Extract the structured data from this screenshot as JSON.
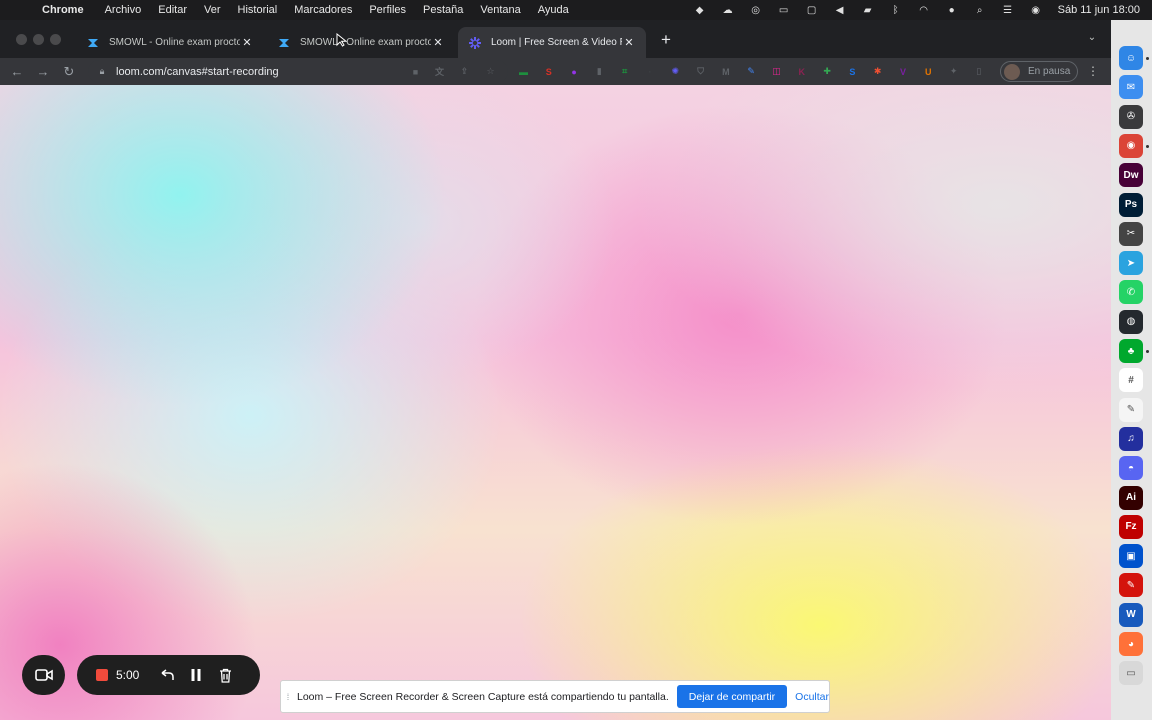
{
  "menubar": {
    "app": "Chrome",
    "items": [
      "Archivo",
      "Editar",
      "Ver",
      "Historial",
      "Marcadores",
      "Perfiles",
      "Pestaña",
      "Ventana",
      "Ayuda"
    ],
    "status_icons": [
      "dropbox-icon",
      "cloud-icon",
      "creative-cloud-icon",
      "screen-icon",
      "display-icon",
      "volume-icon",
      "battery-icon",
      "bluetooth-icon",
      "wifi-icon",
      "user-icon",
      "search-icon",
      "control-center-icon",
      "siri-icon"
    ],
    "clock": "Sáb 11 jun  18:00"
  },
  "tabs": [
    {
      "title": "SMOWL - Online exam proctor",
      "favicon": "smowl-icon",
      "active": false
    },
    {
      "title": "SMOWL - Online exam proctor",
      "favicon": "smowl-icon",
      "active": false
    },
    {
      "title": "Loom | Free Screen & Video Re",
      "favicon": "loom-icon",
      "active": true
    }
  ],
  "toolbar": {
    "url": "loom.com/canvas#start-recording",
    "profile_label": "En pausa"
  },
  "extensions": [
    {
      "name": "camera-icon",
      "color": "#5f6368",
      "glyph": "■"
    },
    {
      "name": "translate-icon",
      "color": "#5f6368",
      "glyph": "文"
    },
    {
      "name": "share-icon",
      "color": "#5f6368",
      "glyph": "⇪"
    },
    {
      "name": "star-icon",
      "color": "#5f6368",
      "glyph": "☆"
    },
    {
      "name": "ext-green-icon",
      "color": "#1e8e3e",
      "glyph": "▬"
    },
    {
      "name": "ext-red-icon",
      "color": "#d93025",
      "glyph": "S"
    },
    {
      "name": "ext-purple-icon",
      "color": "#9334e6",
      "glyph": "●"
    },
    {
      "name": "ext-gray-icon",
      "color": "#5f6368",
      "glyph": "▮"
    },
    {
      "name": "ext-frame-icon",
      "color": "#1e8e3e",
      "glyph": "⌗"
    },
    {
      "name": "ext-dark-icon",
      "color": "#3c4043",
      "glyph": "·"
    },
    {
      "name": "loom-ext-icon",
      "color": "#625df5",
      "glyph": "✺"
    },
    {
      "name": "shield-icon",
      "color": "#5f6368",
      "glyph": "⛉"
    },
    {
      "name": "gmail-icon",
      "color": "#5f6368",
      "glyph": "M"
    },
    {
      "name": "pen-icon",
      "color": "#4285f4",
      "glyph": "✎"
    },
    {
      "name": "ext-pink-icon",
      "color": "#e52592",
      "glyph": "◫"
    },
    {
      "name": "ext-k-icon",
      "color": "#8b2252",
      "glyph": "K"
    },
    {
      "name": "ext-green2-icon",
      "color": "#34a853",
      "glyph": "✚"
    },
    {
      "name": "ext-s-icon",
      "color": "#1a73e8",
      "glyph": "S"
    },
    {
      "name": "ext-orange-icon",
      "color": "#f05032",
      "glyph": "✱"
    },
    {
      "name": "ext-v-icon",
      "color": "#7b1fa2",
      "glyph": "V"
    },
    {
      "name": "ext-u-icon",
      "color": "#e37400",
      "glyph": "U"
    },
    {
      "name": "puzzle-icon",
      "color": "#5f6368",
      "glyph": "✦"
    },
    {
      "name": "sidepanel-icon",
      "color": "#5f6368",
      "glyph": "▯"
    }
  ],
  "dock": [
    {
      "name": "finder-icon",
      "color": "#2f86e6",
      "glyph": "☺"
    },
    {
      "name": "mail-icon",
      "color": "#3d8ef0",
      "glyph": "✉"
    },
    {
      "name": "safari-icon",
      "color": "#3a3a3c",
      "glyph": "✇"
    },
    {
      "name": "chrome-icon",
      "color": "#db4437",
      "glyph": "◉"
    },
    {
      "name": "dreamweaver-icon",
      "color": "#470137",
      "glyph": "Dw"
    },
    {
      "name": "photoshop-icon",
      "color": "#001e36",
      "glyph": "Ps"
    },
    {
      "name": "finalcut-icon",
      "color": "#444444",
      "glyph": "✂"
    },
    {
      "name": "telegram-icon",
      "color": "#2aa3df",
      "glyph": "➤"
    },
    {
      "name": "whatsapp-icon",
      "color": "#25d366",
      "glyph": "✆"
    },
    {
      "name": "github-icon",
      "color": "#24292e",
      "glyph": "◍"
    },
    {
      "name": "evernote-icon",
      "color": "#00a82d",
      "glyph": "♣"
    },
    {
      "name": "slack-icon",
      "color": "#ffffff",
      "glyph": "#"
    },
    {
      "name": "textedit-icon",
      "color": "#f5f5f5",
      "glyph": "✎"
    },
    {
      "name": "amazon-music-icon",
      "color": "#232f9e",
      "glyph": "♫"
    },
    {
      "name": "discord-icon",
      "color": "#5865f2",
      "glyph": "◓"
    },
    {
      "name": "illustrator-icon",
      "color": "#330000",
      "glyph": "Ai"
    },
    {
      "name": "filezilla-icon",
      "color": "#bf0000",
      "glyph": "Fz"
    },
    {
      "name": "sourcetree-icon",
      "color": "#0052cc",
      "glyph": "▣"
    },
    {
      "name": "acrobat-icon",
      "color": "#d4130c",
      "glyph": "✎"
    },
    {
      "name": "word-icon",
      "color": "#185abd",
      "glyph": "W"
    },
    {
      "name": "firefox-icon",
      "color": "#ff7139",
      "glyph": "◕"
    },
    {
      "name": "trash-icon",
      "color": "#d8d8d8",
      "glyph": "▭"
    }
  ],
  "loom": {
    "timer": "5:00"
  },
  "share_banner": {
    "message": "Loom – Free Screen Recorder & Screen Capture está compartiendo tu pantalla.",
    "stop_label": "Dejar de compartir",
    "hide_label": "Ocultar"
  }
}
